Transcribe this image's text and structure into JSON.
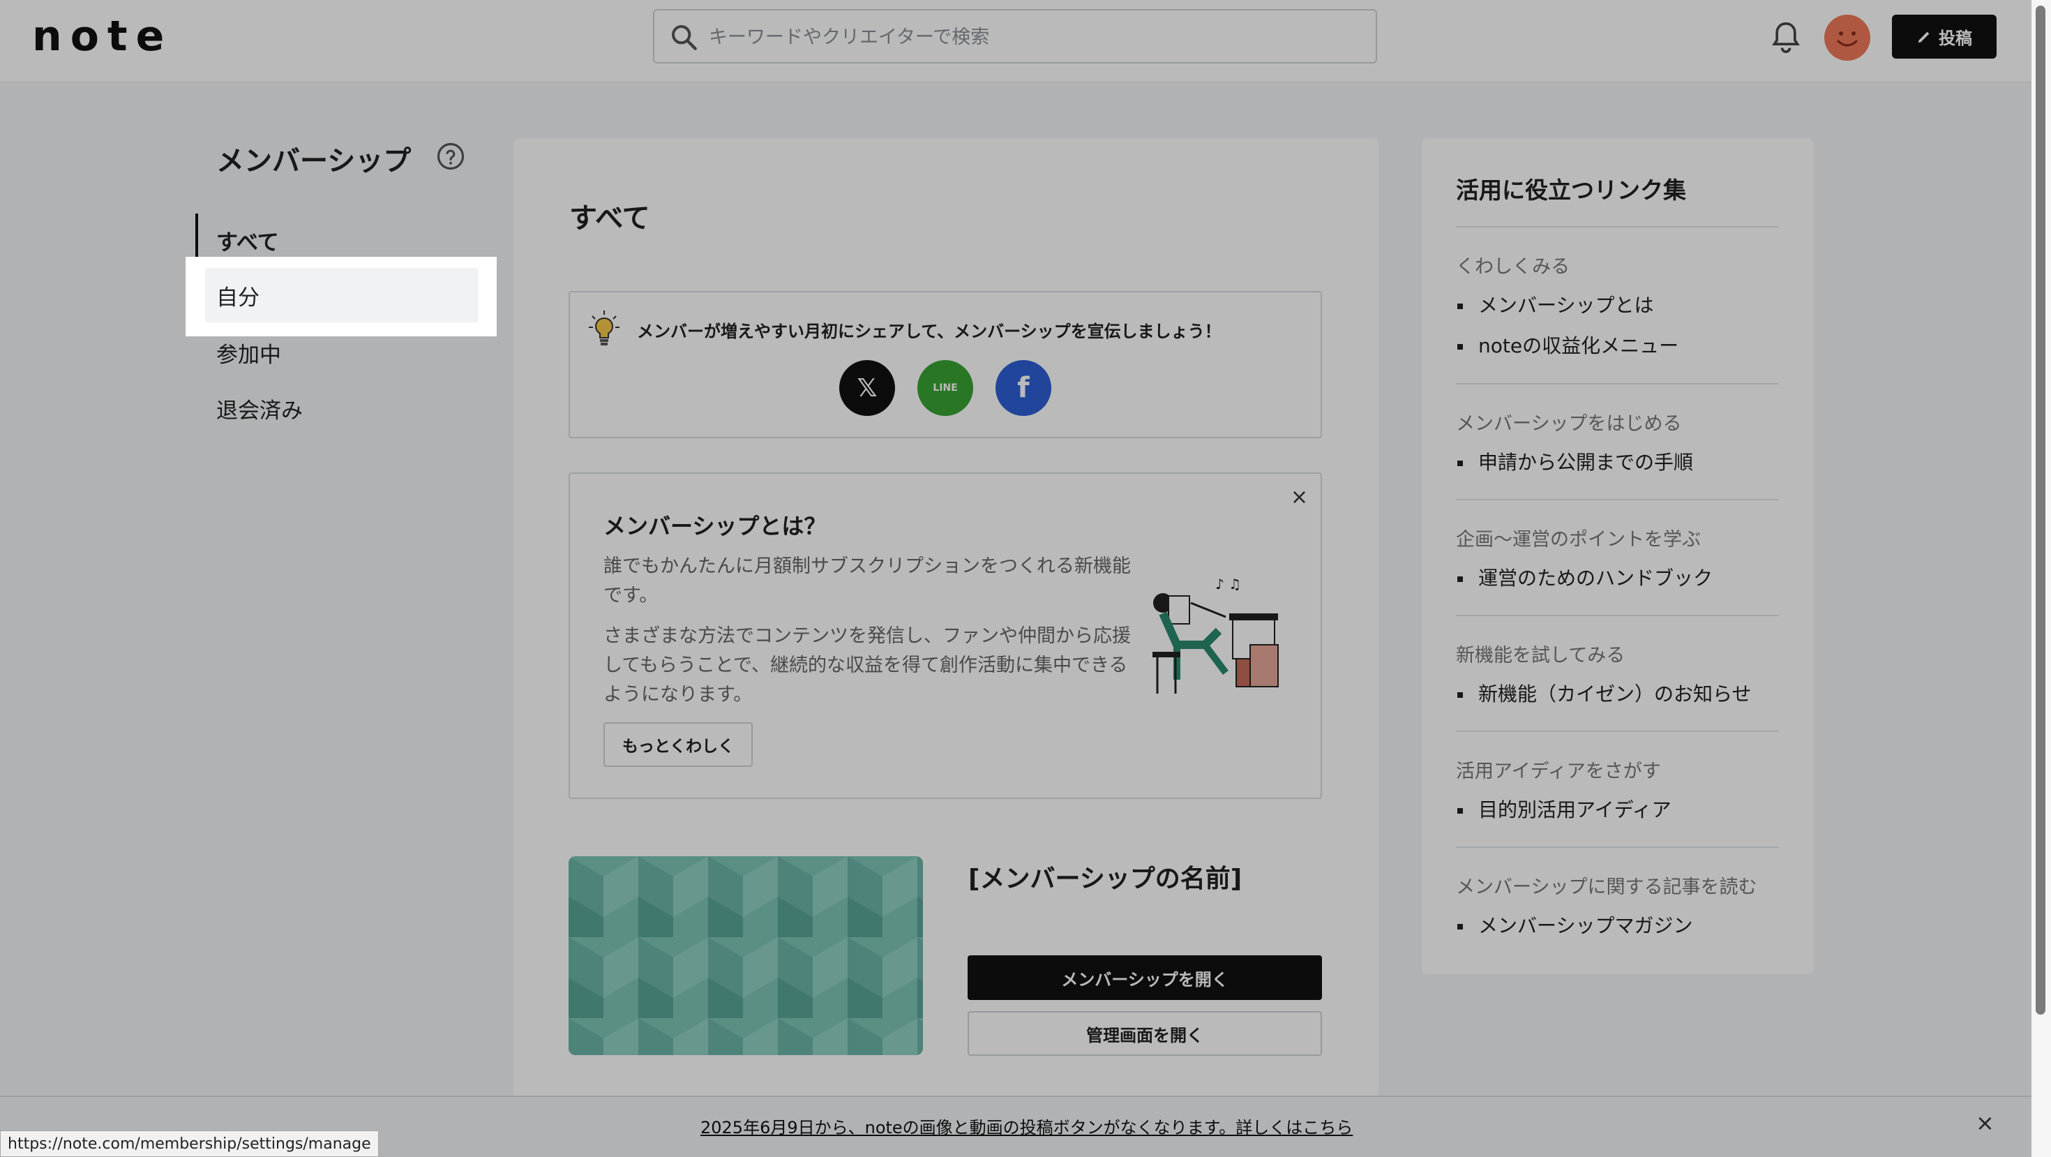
{
  "header": {
    "logo": "note",
    "search_placeholder": "キーワードやクリエイターで検索",
    "post_label": "投稿"
  },
  "nav": {
    "title": "メンバーシップ",
    "items": [
      {
        "label": "すべて"
      },
      {
        "label": "自分"
      },
      {
        "label": "参加中"
      },
      {
        "label": "退会済み"
      }
    ]
  },
  "main": {
    "title": "すべて",
    "share": {
      "message": "メンバーが増えやすい月初にシェアして、メンバーシップを宣伝しましょう！",
      "x_label": "𝕏",
      "line_label": "LINE",
      "facebook_label": "f"
    },
    "about": {
      "close": "×",
      "title": "メンバーシップとは？",
      "p1": "誰でもかんたんに月額制サブスクリプションをつくれる新機能です。",
      "p2": "さまざまな方法でコンテンツを発信し、ファンや仲間から応援してもらうことで、継続的な収益を得て創作活動に集中できるようになります。",
      "more_label": "もっとくわしく"
    },
    "membership": {
      "name": "[メンバーシップの名前]",
      "open_label": "メンバーシップを開く",
      "manage_label": "管理画面を開く"
    }
  },
  "sidebar": {
    "title": "活用に役立つリンク集",
    "sections": [
      {
        "category": "くわしくみる",
        "links": [
          "メンバーシップとは",
          "noteの収益化メニュー"
        ]
      },
      {
        "category": "メンバーシップをはじめる",
        "links": [
          "申請から公開までの手順"
        ]
      },
      {
        "category": "企画〜運営のポイントを学ぶ",
        "links": [
          "運営のためのハンドブック"
        ]
      },
      {
        "category": "新機能を試してみる",
        "links": [
          "新機能（カイゼン）のお知らせ"
        ]
      },
      {
        "category": "活用アイディアをさがす",
        "links": [
          "目的別活用アイディア"
        ]
      },
      {
        "category": "メンバーシップに関する記事を読む",
        "links": [
          "メンバーシップマガジン"
        ]
      }
    ]
  },
  "banner": {
    "text": "2025年6月9日から、noteの画像と動画の投稿ボタンがなくなります。詳しくはこちら",
    "close": "×"
  },
  "status_url": "https://note.com/membership/settings/manage",
  "colors": {
    "avatar": "#f0795a",
    "line_green": "#39a234",
    "facebook_blue": "#2d5fd3",
    "cover_teal": "#7dc4b6"
  }
}
